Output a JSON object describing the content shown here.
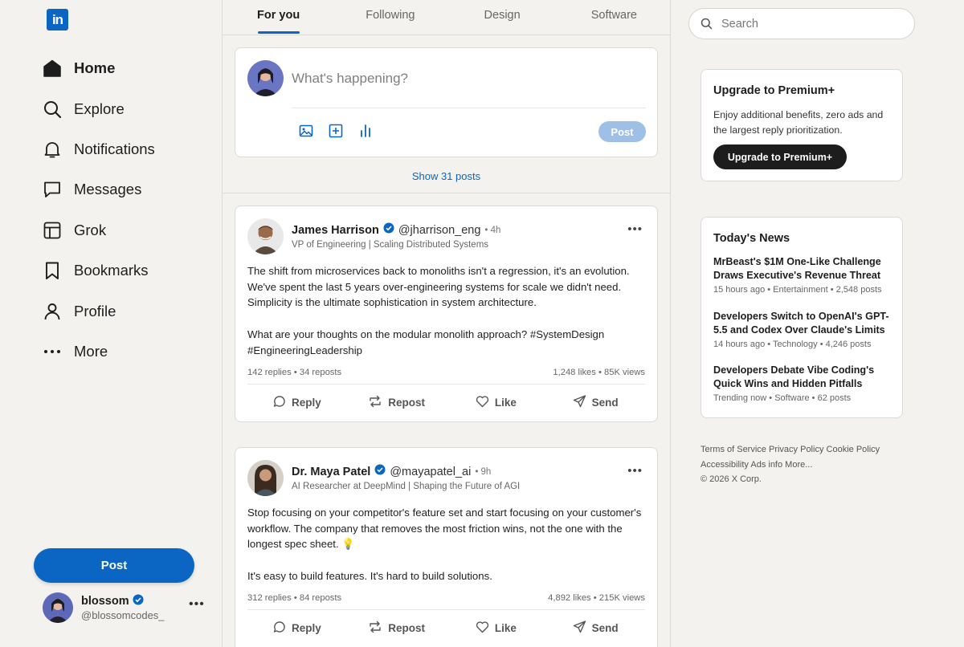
{
  "brand": {
    "logo_text": "in",
    "accent": "#0a66c2"
  },
  "sidebar": {
    "items": [
      {
        "label": "Home",
        "icon": "home-icon",
        "active": true
      },
      {
        "label": "Explore",
        "icon": "search-icon"
      },
      {
        "label": "Notifications",
        "icon": "bell-icon"
      },
      {
        "label": "Messages",
        "icon": "message-icon"
      },
      {
        "label": "Grok",
        "icon": "grok-icon"
      },
      {
        "label": "Bookmarks",
        "icon": "bookmark-icon"
      },
      {
        "label": "Profile",
        "icon": "person-icon"
      },
      {
        "label": "More",
        "icon": "more-icon"
      }
    ],
    "post_button": "Post",
    "user": {
      "name": "blossom",
      "handle": "@blossomcodes_"
    }
  },
  "tabs": [
    "For you",
    "Following",
    "Design",
    "Software"
  ],
  "composer": {
    "placeholder": "What's happening?",
    "tools": [
      "image-icon",
      "add-media-icon",
      "poll-icon"
    ],
    "post_label": "Post"
  },
  "show_posts": "Show 31 posts",
  "posts": [
    {
      "name": "James Harrison",
      "handle": "@jharrison_eng",
      "time": "• 4h",
      "title": "VP of Engineering | Scaling Distributed Systems",
      "body": [
        "The shift from microservices back to monoliths isn't a regression, it's an evolution.",
        "We've spent the last 5 years over-engineering systems for scale we didn't need.",
        "Simplicity is the ultimate sophistication in system architecture.",
        "",
        "What are your thoughts on the modular monolith approach? #SystemDesign",
        "#EngineeringLeadership"
      ],
      "stats_left": "142 replies • 34 reposts",
      "stats_right": "1,248 likes • 85K views",
      "actions": [
        "Reply",
        "Repost",
        "Like",
        "Send"
      ]
    },
    {
      "name": "Dr. Maya Patel",
      "handle": "@mayapatel_ai",
      "time": "• 9h",
      "title": "AI Researcher at DeepMind | Shaping the Future of AGI",
      "body": [
        "Stop focusing on your competitor's feature set and start focusing on your customer's",
        "workflow. The company that removes the most friction wins, not the one with the",
        "longest spec sheet. 💡",
        "",
        "It's easy to build features. It's hard to build solutions."
      ],
      "stats_left": "312 replies • 84 reposts",
      "stats_right": "4,892 likes • 215K views",
      "actions": [
        "Reply",
        "Repost",
        "Like",
        "Send"
      ]
    }
  ],
  "search": {
    "placeholder": "Search"
  },
  "premium": {
    "title": "Upgrade to Premium+",
    "description": "Enjoy additional benefits, zero ads and the largest reply prioritization.",
    "button": "Upgrade to Premium+"
  },
  "news": {
    "title": "Today's News",
    "items": [
      {
        "headline": "MrBeast's $1M One-Like Challenge Draws Executive's Revenue Threat",
        "meta": "15 hours ago • Entertainment • 2,548 posts"
      },
      {
        "headline": "Developers Switch to OpenAI's GPT-5.5 and Codex Over Claude's Limits",
        "meta": "14 hours ago • Technology • 4,246 posts"
      },
      {
        "headline": "Developers Debate Vibe Coding's Quick Wins and Hidden Pitfalls",
        "meta": "Trending now • Software • 62 posts"
      }
    ]
  },
  "footer": {
    "links": [
      "Terms of Service",
      "Privacy Policy",
      "Cookie Policy",
      "Accessibility",
      "Ads info",
      "More..."
    ],
    "copyright": "© 2026 X Corp."
  }
}
